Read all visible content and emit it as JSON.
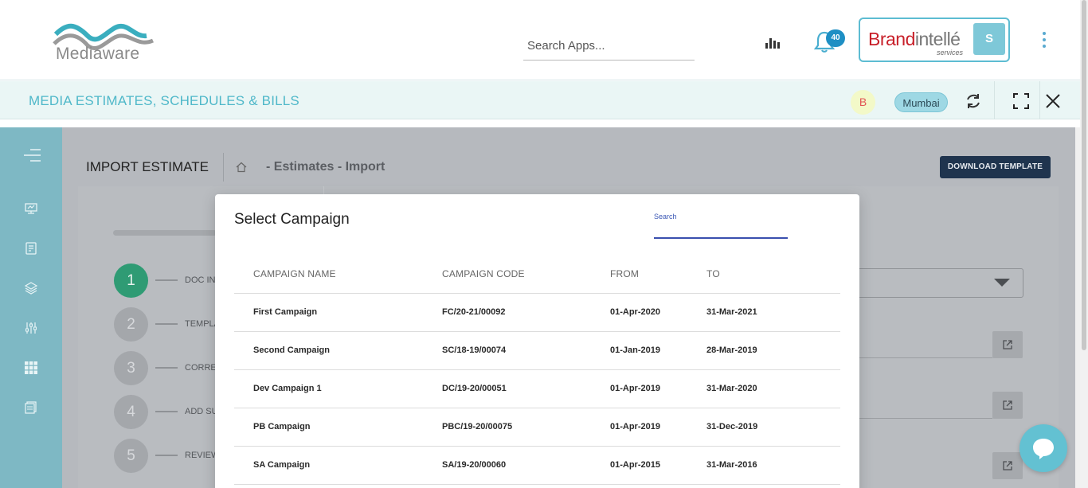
{
  "header": {
    "logo_text": "Mediaware",
    "search_placeholder": "Search Apps...",
    "notifications_count": "40",
    "brand": {
      "part1": "Brand",
      "part2": "intellé",
      "sub": "services"
    },
    "user_initial": "S"
  },
  "titlebar": {
    "title": "MEDIA ESTIMATES, SCHEDULES & BILLS",
    "b_avatar": "B",
    "city": "Mumbai"
  },
  "sidebar": {
    "icons": [
      "menu-icon",
      "dashboard-icon",
      "estimate-icon",
      "layers-icon",
      "sliders-icon",
      "grid-icon",
      "stack-icon"
    ]
  },
  "page": {
    "heading": "IMPORT ESTIMATE",
    "breadcrumb": "- Estimates - Import",
    "download_template": "DOWNLOAD TEMPLATE",
    "steps": [
      {
        "num": "1",
        "label": "DOC IN"
      },
      {
        "num": "2",
        "label": "TEMPLA"
      },
      {
        "num": "3",
        "label": "CORRE"
      },
      {
        "num": "4",
        "label": "ADD SU"
      },
      {
        "num": "5",
        "label": "REVIEW"
      }
    ]
  },
  "modal": {
    "title": "Select Campaign",
    "search_label": "Search",
    "columns": [
      "CAMPAIGN NAME",
      "CAMPAIGN CODE",
      "FROM",
      "TO"
    ],
    "rows": [
      [
        "First Campaign",
        "FC/20-21/00092",
        "01-Apr-2020",
        "31-Mar-2021"
      ],
      [
        "Second Campaign",
        "SC/18-19/00074",
        "01-Jan-2019",
        "28-Mar-2019"
      ],
      [
        "Dev Campaign 1",
        "DC/19-20/00051",
        "01-Apr-2019",
        "31-Mar-2020"
      ],
      [
        "PB Campaign",
        "PBC/19-20/00075",
        "01-Apr-2019",
        "31-Dec-2019"
      ],
      [
        "SA Campaign",
        "SA/19-20/00060",
        "01-Apr-2015",
        "31-Mar-2016"
      ]
    ]
  },
  "colors": {
    "accent": "#4fb8c9",
    "sidebar": "#7eb8c4",
    "button_dark": "#1f344e",
    "step_active": "#2f9b74"
  }
}
